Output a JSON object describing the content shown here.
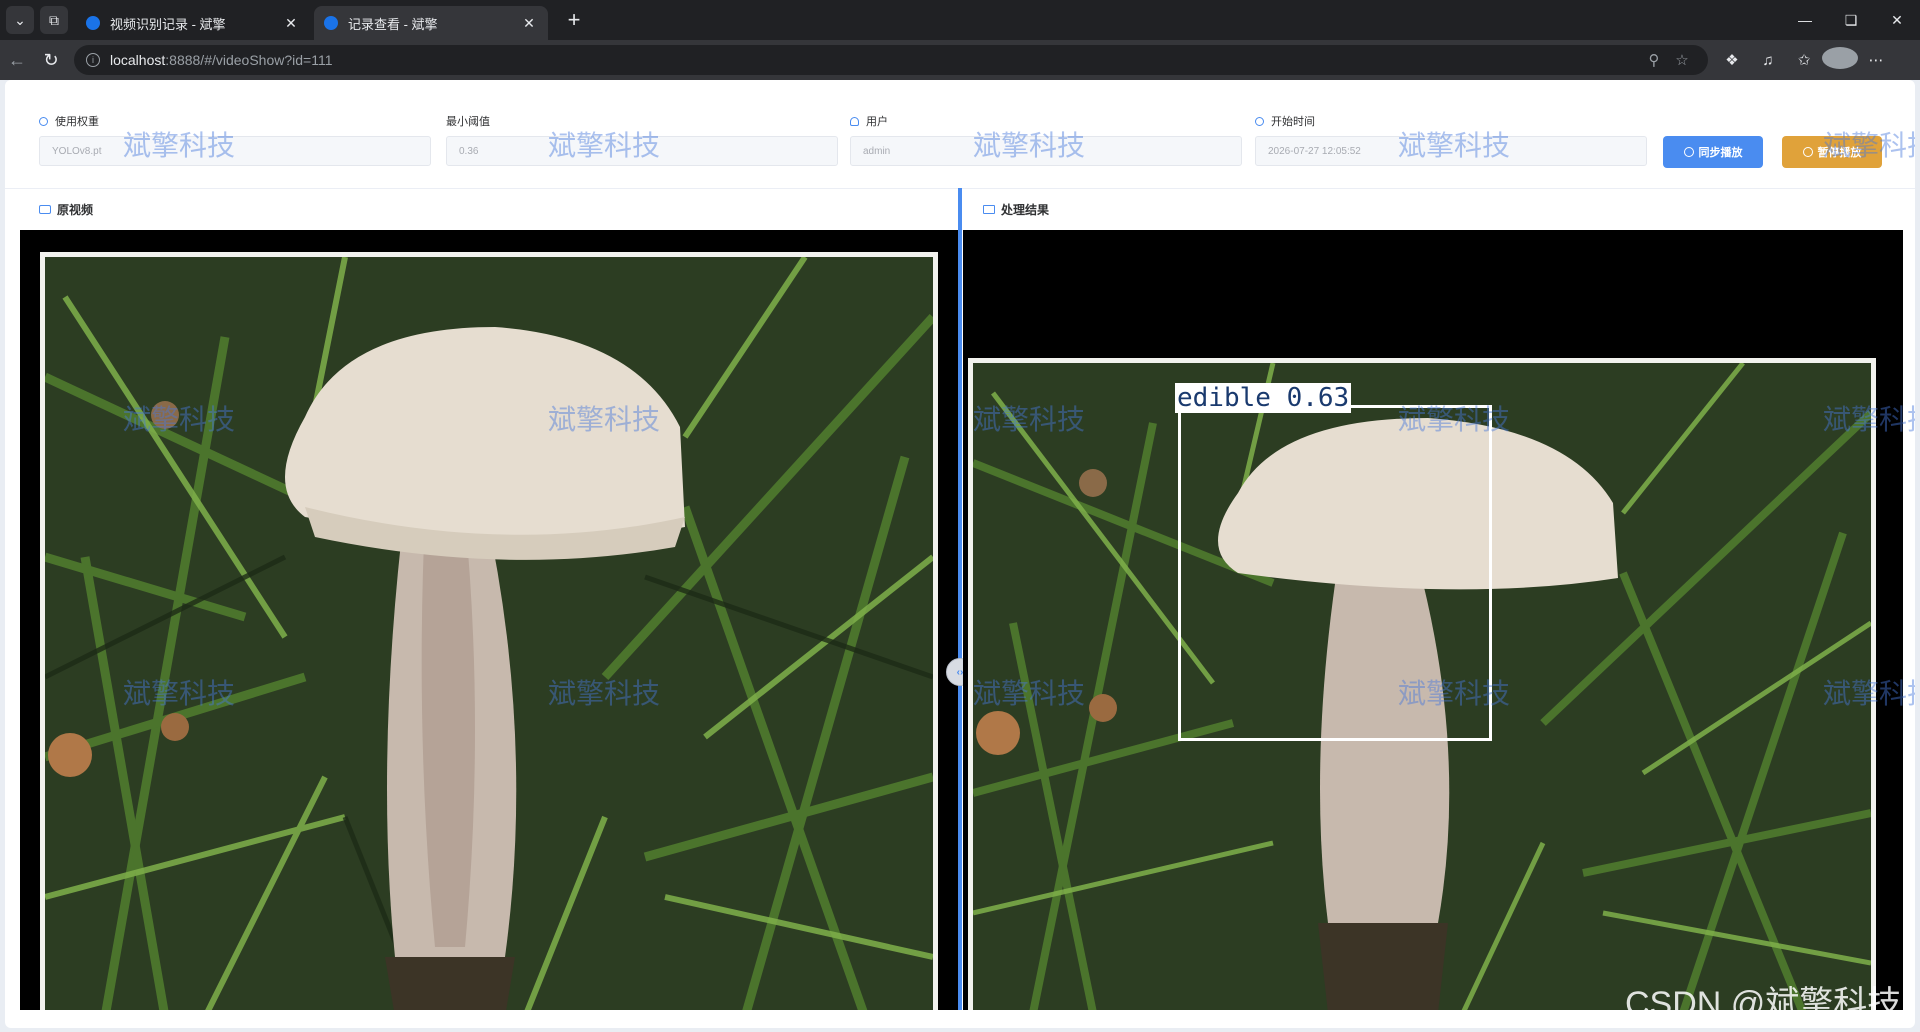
{
  "browser": {
    "tabs": [
      {
        "title": "视频识别记录 - 斌擎",
        "active": false
      },
      {
        "title": "记录查看 - 斌擎",
        "active": true
      }
    ],
    "url_host": "localhost",
    "url_rest": ":8888/#/videoShow?id=111"
  },
  "form": {
    "weight": {
      "label": "使用权重",
      "value": "YOLOv8.pt"
    },
    "threshold": {
      "label": "最小阈值",
      "value": "0.36"
    },
    "user": {
      "label": "用户",
      "value": "admin"
    },
    "start_time": {
      "label": "开始时间",
      "value": "2026-07-27 12:05:52"
    },
    "sync_button": "同步播放",
    "pause_button": "暂停播放"
  },
  "panels": {
    "original_title": "原视频",
    "result_title": "处理结果"
  },
  "detection": {
    "label": "edible 0.63"
  },
  "watermark": "斌擎科技",
  "csdn_mark": "CSDN @斌擎科技",
  "colors": {
    "accent": "#4a8cf0",
    "warning": "#e0a23a"
  }
}
